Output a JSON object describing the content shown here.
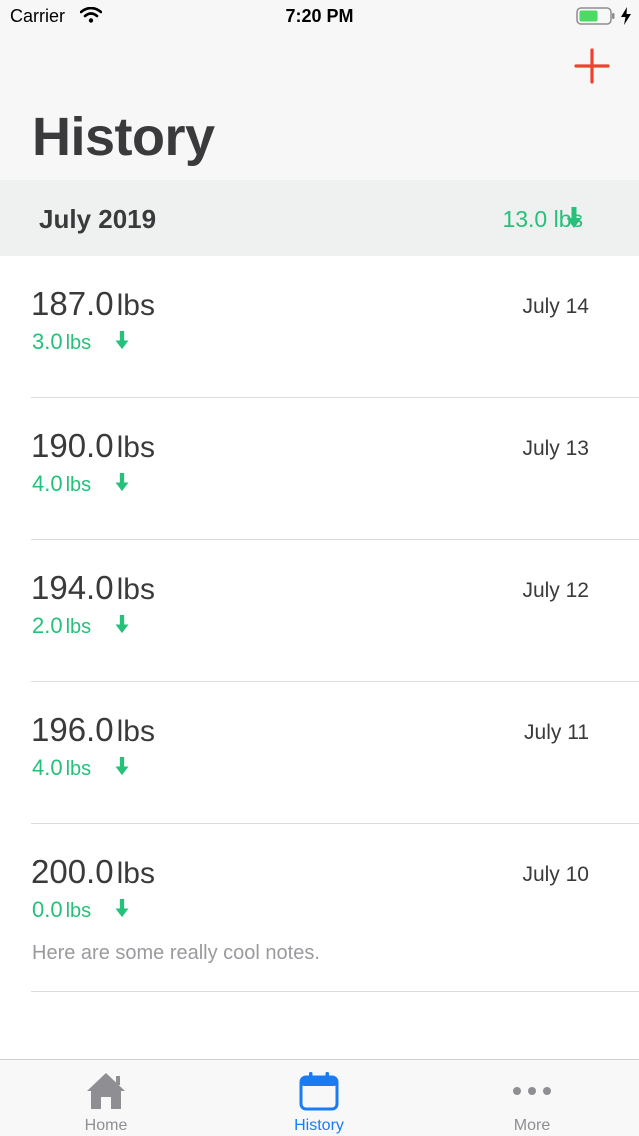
{
  "status_bar": {
    "carrier": "Carrier",
    "time": "7:20 PM"
  },
  "nav": {
    "title": "History",
    "add_icon": "plus-icon",
    "accent_color": "#f0412e"
  },
  "section": {
    "month": "July 2019",
    "total_change": "13.0 lbs",
    "change_color": "#24c17a"
  },
  "entries": [
    {
      "weight": "187.0",
      "unit": "lbs",
      "date": "July 14",
      "change": "3.0",
      "change_unit": "lbs",
      "notes": ""
    },
    {
      "weight": "190.0",
      "unit": "lbs",
      "date": "July 13",
      "change": "4.0",
      "change_unit": "lbs",
      "notes": ""
    },
    {
      "weight": "194.0",
      "unit": "lbs",
      "date": "July 12",
      "change": "2.0",
      "change_unit": "lbs",
      "notes": ""
    },
    {
      "weight": "196.0",
      "unit": "lbs",
      "date": "July 11",
      "change": "4.0",
      "change_unit": "lbs",
      "notes": ""
    },
    {
      "weight": "200.0",
      "unit": "lbs",
      "date": "July 10",
      "change": "0.0",
      "change_unit": "lbs",
      "notes": "Here are some really cool notes."
    }
  ],
  "tabs": [
    {
      "label": "Home",
      "icon": "home-icon",
      "active": false
    },
    {
      "label": "History",
      "icon": "calendar-icon",
      "active": true
    },
    {
      "label": "More",
      "icon": "more-icon",
      "active": false
    }
  ],
  "tab_active_color": "#1a7cf5"
}
